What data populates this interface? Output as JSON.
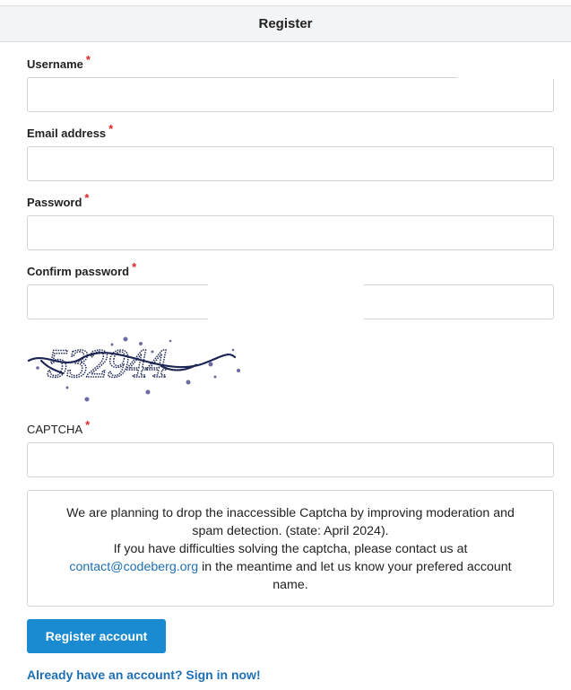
{
  "header": {
    "title": "Register"
  },
  "form": {
    "username": {
      "label": "Username",
      "required_mark": "*",
      "value": "",
      "placeholder": ""
    },
    "email": {
      "label": "Email address",
      "required_mark": "*",
      "value": "",
      "placeholder": ""
    },
    "password": {
      "label": "Password",
      "required_mark": "*",
      "value": "",
      "placeholder": ""
    },
    "confirm_password": {
      "label": "Confirm password",
      "required_mark": "*",
      "value": "",
      "placeholder": ""
    },
    "captcha_image": {
      "text": "532944"
    },
    "captcha": {
      "label": "CAPTCHA",
      "required_mark": "*",
      "value": "",
      "placeholder": ""
    }
  },
  "notice": {
    "line1": "We are planning to drop the inaccessible Captcha by improving moderation and spam detection. (state: April 2024).",
    "line2_before": "If you have difficulties solving the captcha, please contact us at",
    "email_link": "contact@codeberg.org",
    "line2_after": "in the meantime and let us know your prefered account name."
  },
  "actions": {
    "register_label": "Register account",
    "signin_label": "Already have an account? Sign in now!"
  },
  "colors": {
    "accent": "#1a8bd1",
    "link": "#1f6fb4",
    "required": "#db2828",
    "captcha_ink": "#1b2452"
  }
}
